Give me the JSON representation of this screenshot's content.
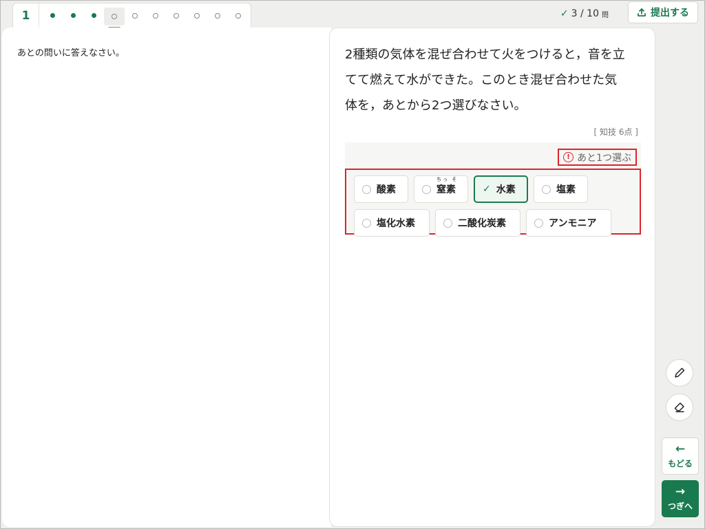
{
  "nav": {
    "question_number": "1",
    "dots": [
      "done",
      "done",
      "done",
      "current",
      "todo",
      "todo",
      "todo",
      "todo",
      "todo",
      "todo"
    ]
  },
  "progress": {
    "check_icon": "check-icon",
    "value": "3 / 10",
    "unit": "問"
  },
  "submit": {
    "label": "提出する",
    "icon": "upload-icon"
  },
  "left": {
    "instruction": "あとの問いに答えなさい。"
  },
  "question": {
    "line1": "2種類の気体を混ぜ合わせて火をつけると，音を立",
    "line2": "てて燃えて水ができた。このとき混ぜ合わせた気",
    "line3": "体を，あとから2つ選びなさい。",
    "points": "[ 知技 6点 ]"
  },
  "answer": {
    "remaining": "あと1つ選ぶ",
    "choices": [
      {
        "label": "酸素",
        "selected": false
      },
      {
        "label": "窒素",
        "ruby": "ちっ そ",
        "selected": false
      },
      {
        "label": "水素",
        "selected": true
      },
      {
        "label": "塩素",
        "selected": false
      },
      {
        "label": "塩化水素",
        "selected": false
      },
      {
        "label": "二酸化炭素",
        "selected": false
      },
      {
        "label": "アンモニア",
        "selected": false
      }
    ]
  },
  "tools": {
    "pen": "pencil-icon",
    "eraser": "eraser-icon"
  },
  "buttons": {
    "back": "もどる",
    "next": "つぎへ"
  },
  "colors": {
    "accent": "#1a7a4f",
    "alert": "#d9252b"
  }
}
